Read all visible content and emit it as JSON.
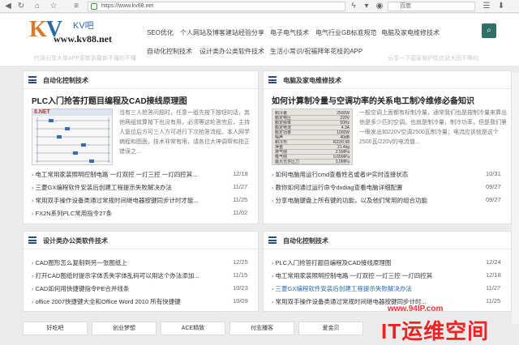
{
  "browser": {
    "url": "https://www.kv88.net",
    "search_engine": "百度"
  },
  "header": {
    "logo_text": "KV吧",
    "logo_url": "www.kv88.net",
    "nav_row1": [
      "SEO优化",
      "个人网站及博客建站经验分享",
      "电子电气技术",
      "电气行业GB标准规范",
      "电脑及家电维修技术"
    ],
    "nav_row2": [
      "自动化控制技术",
      "设计类办公类软件技术",
      "生活小常识/祝福拜年花枝的APP"
    ],
    "faint_text_left": "代读分享大单APP更新到最新不懂的不懂",
    "faint_text_right": "分享一下国家保护性信息大团不等的"
  },
  "panels": [
    {
      "title": "自动化控制技术",
      "article_title": "PLC入门抢答打题目编程及CAD接线原理图",
      "thumb_label": "8.NET",
      "excerpt": "当有三人抢答问题时，任意一组先按下按钮的话，其他两组就算按下也没有用，必须等这轮答完后，主持人复位后方可三人方可进行下次抢答流程。本人网学病程和图面，技术非常有限，请各位大神调帮和指正错误之...",
      "items": [
        [
          "电工常用家装照明控制电路 一灯双控 一灯三控 一灯四控其...",
          "12/18"
        ],
        [
          "三菱GX编程软件安装后创建工程提示失败解决办法",
          "11/27"
        ],
        [
          "常用双手操作设备类通过常规时间继电器按键同步计时才能...",
          "11/25"
        ],
        [
          "FX2N系列PLC常用指令27条",
          "11/02"
        ]
      ]
    },
    {
      "title": "电脑及家电维修技术",
      "article_title": "如何计算制冷量与空调功率的关系电工制冷维修必备知识",
      "thumb_rows": [
        [
          "制冷量",
          "2500W"
        ],
        [
          "额定电压",
          "220V"
        ],
        [
          "额定频率",
          "50Hz"
        ],
        [
          "额定电流",
          "4.3A"
        ],
        [
          "额定功率",
          "1000W"
        ],
        [
          "噪声",
          "40dB"
        ],
        [
          "制冷剂",
          "R22/0.98"
        ],
        [
          "净重",
          "21.4kg"
        ],
        [
          "排气侧",
          "2.5MPa"
        ],
        [
          "吸气侧",
          "0.65MPa"
        ],
        [
          "最大允许压力",
          "3.0MPa"
        ]
      ],
      "excerpt": "一般空调上面都有标制冷量，通常我们也是按制冷量来算出他是多少匹的空调。也就是制冷量，制冷功率，但是我们第一眼发出如220V空调2500瓦制冷量；电流应该就是这个2500瓦/220V的电流值...",
      "items": [
        [
          "如何电脑用运行cmd查看姓名或者IP实时连接状态",
          "10/31"
        ],
        [
          "教你如何通过运行命令dxdiag查看电脑详细配置",
          "09/27"
        ],
        [
          "分享电脑键盘上所有键的功能，以及他们常用的组合功能",
          "09/27"
        ]
      ]
    },
    {
      "title": "设计类办公类软件技术",
      "items": [
        [
          "CAD图形怎么复制到另一张图纸上",
          "12/25"
        ],
        [
          "打开CAD图纸时提示字体丢失字体乱码可以用这个办法添加...",
          "11/15"
        ],
        [
          "CAD如何用快捷键指令PE合并线条",
          "10/23"
        ],
        [
          "office 2007快捷键大全和Office Word 2010 所有快捷键",
          "10/09"
        ]
      ]
    },
    {
      "title": "自动化控制技术",
      "items": [
        [
          "PLC入门抢答打题目编程及CAD接线原理图",
          "12/24"
        ],
        [
          "电工常用家装照明控制电路 一灯双控 一灯三控 一灯四控其",
          "12/18"
        ],
        [
          "三菱GX编程软件安装后创建工程提示失败解决办法",
          "11/27"
        ],
        [
          "常用双手操作设备类通过常规时间继电器按键同步计时...",
          "11/25"
        ]
      ]
    }
  ],
  "tags": [
    "好吃吧",
    "创业梦想",
    "ACE精致",
    "付志播客",
    "爱金贝"
  ],
  "watermark": {
    "line1": "www.94IP.com",
    "line2": "IT运维空间"
  }
}
